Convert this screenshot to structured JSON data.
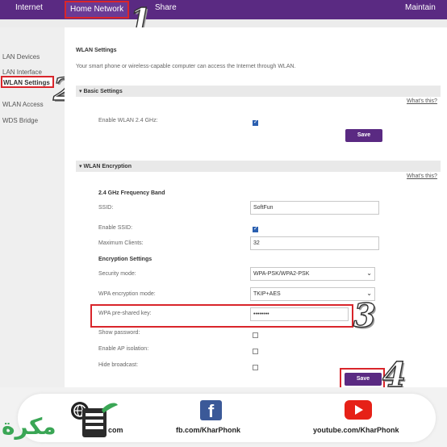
{
  "topnav": {
    "items": [
      "Internet",
      "Home Network",
      "Share",
      "Maintain"
    ],
    "active": "Home Network"
  },
  "sidebar": {
    "items": [
      "LAN Devices",
      "LAN Interface",
      "WLAN Settings",
      "WLAN Access",
      "WDS Bridge"
    ],
    "active": "WLAN Settings"
  },
  "main": {
    "title": "WLAN Settings",
    "description": "Your smart phone or wireless-capable computer can access the Internet through WLAN.",
    "basic": {
      "header": "Basic Settings",
      "help": "What's this?",
      "enable_label": "Enable WLAN 2.4 GHz:",
      "enable_checked": true,
      "save": "Save"
    },
    "encryption": {
      "header": "WLAN Encryption",
      "help": "What's this?",
      "band_label": "2.4 GHz Frequency Band",
      "ssid_label": "SSID:",
      "ssid_value": "SoftFun",
      "enable_ssid_label": "Enable SSID:",
      "enable_ssid_checked": true,
      "max_clients_label": "Maximum Clients:",
      "max_clients_value": "32",
      "enc_settings_label": "Encryption Settings",
      "security_label": "Security mode:",
      "security_value": "WPA-PSK/WPA2-PSK",
      "wpa_mode_label": "WPA encryption mode:",
      "wpa_mode_value": "TKIP+AES",
      "psk_label": "WPA pre-shared key:",
      "psk_value": "••••••••",
      "show_password_label": "Show password:",
      "ap_isolation_label": "Enable AP isolation:",
      "hide_broadcast_label": "Hide broadcast:",
      "save": "Save"
    }
  },
  "annotations": [
    "1",
    "2",
    "3",
    "4"
  ],
  "footer": {
    "website": "com",
    "facebook": "fb.com/KharPhonk",
    "youtube": "youtube.com/KharPhonk",
    "logo_text": "مكرة"
  },
  "colors": {
    "brand": "#5a2a82",
    "highlight": "#d9252b",
    "checkbox": "#2a5fb0",
    "facebook": "#3b5998",
    "youtube": "#e62117",
    "logo_green": "#3aa655"
  }
}
